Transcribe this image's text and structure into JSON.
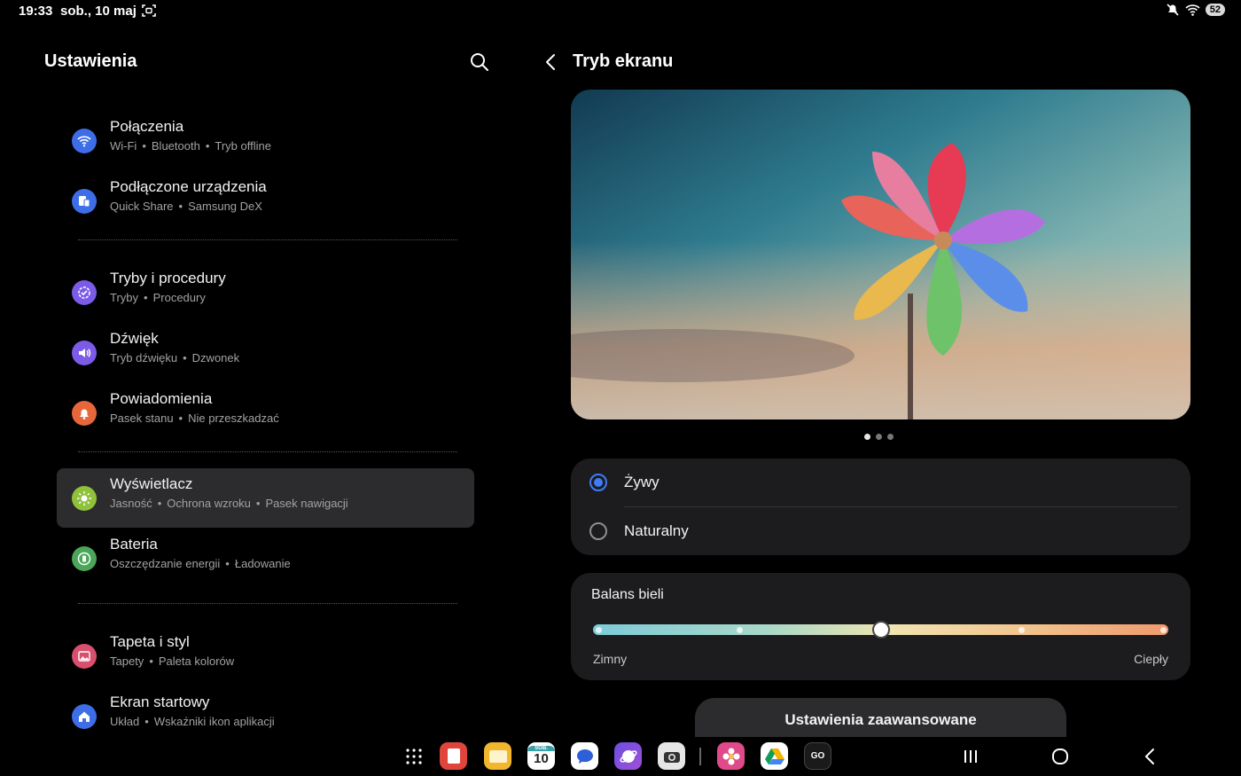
{
  "status": {
    "time": "19:33",
    "date": "sob., 10 maj",
    "battery": "52"
  },
  "left": {
    "title": "Ustawienia",
    "items": [
      {
        "title": "Połączenia",
        "subs": [
          "Wi-Fi",
          "Bluetooth",
          "Tryb offline"
        ],
        "icon": "wifi-icon",
        "color": "#3d6ee8"
      },
      {
        "title": "Podłączone urządzenia",
        "subs": [
          "Quick Share",
          "Samsung DeX"
        ],
        "icon": "devices-icon",
        "color": "#3d6ee8"
      },
      {
        "title": "Tryby i procedury",
        "subs": [
          "Tryby",
          "Procedury"
        ],
        "icon": "modes-icon",
        "color": "#7b5be8"
      },
      {
        "title": "Dźwięk",
        "subs": [
          "Tryb dźwięku",
          "Dzwonek"
        ],
        "icon": "sound-icon",
        "color": "#7b5be8"
      },
      {
        "title": "Powiadomienia",
        "subs": [
          "Pasek stanu",
          "Nie przeszkadzać"
        ],
        "icon": "bell-icon",
        "color": "#e8673a"
      },
      {
        "title": "Wyświetlacz",
        "subs": [
          "Jasność",
          "Ochrona wzroku",
          "Pasek nawigacji"
        ],
        "icon": "sun-icon",
        "color": "#8fc13a",
        "active": true
      },
      {
        "title": "Bateria",
        "subs": [
          "Oszczędzanie energii",
          "Ładowanie"
        ],
        "icon": "battery-icon",
        "color": "#4ba65a"
      },
      {
        "title": "Tapeta i styl",
        "subs": [
          "Tapety",
          "Paleta kolorów"
        ],
        "icon": "wallpaper-icon",
        "color": "#d9506e"
      },
      {
        "title": "Ekran startowy",
        "subs": [
          "Układ",
          "Wskaźniki ikon aplikacji"
        ],
        "icon": "home-icon",
        "color": "#3d6ee8"
      }
    ]
  },
  "right": {
    "title": "Tryb ekranu",
    "modes": [
      {
        "label": "Żywy",
        "checked": true
      },
      {
        "label": "Naturalny",
        "checked": false
      }
    ],
    "white_balance": {
      "title": "Balans bieli",
      "min_label": "Zimny",
      "max_label": "Ciepły",
      "value_fraction": 0.5,
      "steps": 5
    },
    "advanced_label": "Ustawienia zaawansowane"
  },
  "taskbar": {
    "apps": [
      "apps-grid-icon",
      "notes-icon",
      "files-icon",
      "calendar-icon",
      "messages-icon",
      "internet-icon",
      "camera-icon",
      "gallery-icon",
      "drive-icon",
      "tvp-go-icon"
    ],
    "calendar_day": "10",
    "calendar_weekday": "SOB.",
    "tvp_text": "GO"
  },
  "accent": "#3e7bf6"
}
